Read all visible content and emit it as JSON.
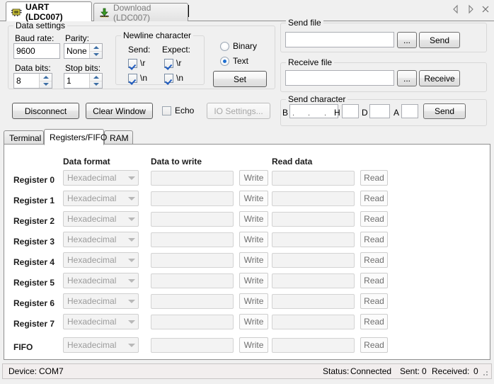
{
  "window": {
    "top_tabs": [
      {
        "label": "UART (LDC007)",
        "icon": "chip-icon",
        "active": true
      },
      {
        "label": "Download (LDC007)",
        "icon": "download-arrow-icon",
        "active": false
      }
    ],
    "nav_prev": "◁",
    "nav_next": "▷",
    "close": "✕"
  },
  "data_settings": {
    "title": "Data settings",
    "baud_rate_label": "Baud rate:",
    "baud_rate_value": "9600",
    "parity_label": "Parity:",
    "parity_value": "None",
    "data_bits_label": "Data bits:",
    "data_bits_value": "8",
    "stop_bits_label": "Stop bits:",
    "stop_bits_value": "1",
    "newline": {
      "title": "Newline character",
      "send_label": "Send:",
      "expect_label": "Expect:",
      "send_cr": "\\r",
      "send_lf": "\\n",
      "expect_cr": "\\r",
      "expect_lf": "\\n",
      "send_cr_checked": true,
      "send_lf_checked": true,
      "expect_cr_checked": true,
      "expect_lf_checked": true
    },
    "mode_binary": "Binary",
    "mode_text": "Text",
    "mode_selected": "Text",
    "set_button": "Set"
  },
  "actions": {
    "disconnect": "Disconnect",
    "clear_window": "Clear Window",
    "echo_label": "Echo",
    "echo_checked": false,
    "io_settings": "IO Settings...",
    "io_settings_enabled": false
  },
  "send_file": {
    "title": "Send file",
    "path_value": "",
    "browse": "...",
    "send": "Send"
  },
  "receive_file": {
    "title": "Receive file",
    "path_value": "",
    "browse": "...",
    "receive": "Receive"
  },
  "send_character": {
    "title": "Send character",
    "bin_label": "B",
    "bin_value": "",
    "hex_label": "H",
    "hex_value": "",
    "dec_label": "D",
    "dec_value": "",
    "ascii_label": "A",
    "ascii_value": "",
    "send": "Send"
  },
  "lower_tabs": [
    {
      "label": "Terminal",
      "active": false
    },
    {
      "label": "Registers/FIFO",
      "active": true
    },
    {
      "label": "RAM",
      "active": false
    }
  ],
  "registers_panel": {
    "headers": {
      "data_format": "Data format",
      "data_to_write": "Data to write",
      "read_data": "Read data"
    },
    "write_button": "Write",
    "read_button": "Read",
    "rows": [
      {
        "name": "Register 0",
        "format": "Hexadecimal",
        "write_value": "",
        "read_value": ""
      },
      {
        "name": "Register 1",
        "format": "Hexadecimal",
        "write_value": "",
        "read_value": ""
      },
      {
        "name": "Register 2",
        "format": "Hexadecimal",
        "write_value": "",
        "read_value": ""
      },
      {
        "name": "Register 3",
        "format": "Hexadecimal",
        "write_value": "",
        "read_value": ""
      },
      {
        "name": "Register 4",
        "format": "Hexadecimal",
        "write_value": "",
        "read_value": ""
      },
      {
        "name": "Register 5",
        "format": "Hexadecimal",
        "write_value": "",
        "read_value": ""
      },
      {
        "name": "Register 6",
        "format": "Hexadecimal",
        "write_value": "",
        "read_value": ""
      },
      {
        "name": "Register 7",
        "format": "Hexadecimal",
        "write_value": "",
        "read_value": ""
      },
      {
        "name": "FIFO",
        "format": "Hexadecimal",
        "write_value": "",
        "read_value": ""
      }
    ]
  },
  "status_bar": {
    "device_label": "Device:",
    "device_value": "COM7",
    "status_label": "Status:",
    "status_value": "Connected",
    "sent_label": "Sent:",
    "sent_value": "0",
    "received_label": "Received:",
    "received_value": "0"
  },
  "colors": {
    "window_bg": "#f0f0f0",
    "panel_bg": "#ffffff",
    "accent_blue": "#1f6fd0",
    "disabled_text": "#9b9b9b",
    "status_bg": "#f2eeee"
  }
}
